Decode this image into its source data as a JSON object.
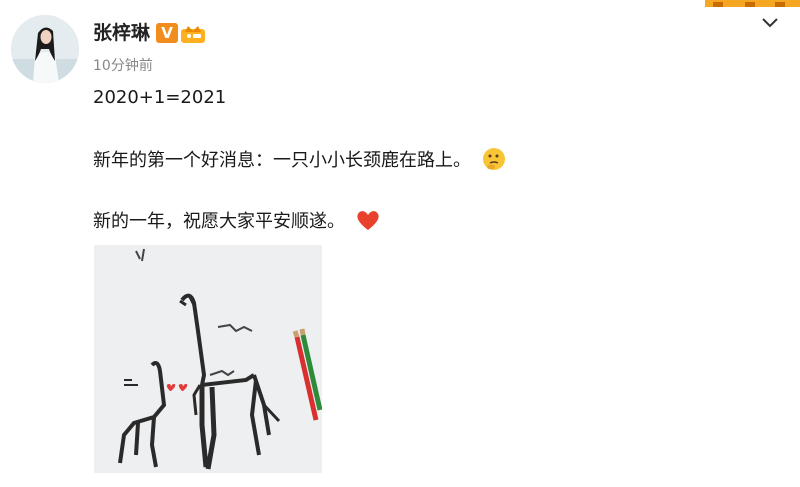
{
  "post": {
    "author": "张梓琳",
    "verified_badge": "V",
    "timestamp": "10分钟前",
    "lines": [
      "2020+1=2021",
      "新年的第一个好消息：一只小小长颈鹿在路上。",
      "新的一年，祝愿大家平安顺遂。"
    ],
    "emojis": [
      "thinking-face-icon",
      "red-heart-icon"
    ],
    "image": "drawing-of-giraffes-photo"
  },
  "colors": {
    "badge": "#f08d1c",
    "timestamp": "#888888",
    "heart": "#e8412c"
  }
}
